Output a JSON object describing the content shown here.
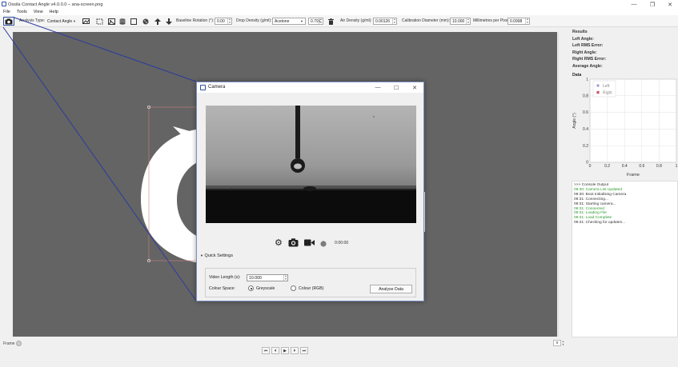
{
  "window": {
    "title": "Ossila Contact Angle v4.0.0.0 – ana-screen.png",
    "minimize": "—",
    "maximize": "❐",
    "close": "✕"
  },
  "menu": [
    "File",
    "Tools",
    "View",
    "Help"
  ],
  "toolbar": {
    "analysis_type_label": "Analysis Type:",
    "analysis_type_value": "Contact Angle",
    "baseline_rotation_label": "Baseline Rotation (°):",
    "baseline_rotation_value": "0.00",
    "drop_density_label": "Drop Density (g/ml):",
    "drop_density_value": "Acetone",
    "drop_density_number": "0.791",
    "air_density_label": "Air Density (g/ml):",
    "air_density_value": "0.00126",
    "calibration_label": "Calibration Diameter (mm):",
    "calibration_value": "10.000",
    "mm_per_pixel_label": "Millimetres per Pixel:",
    "mm_per_pixel_value": "0.0998"
  },
  "results": {
    "heading": "Results",
    "rows": [
      "Left Angle:",
      "Left RMS Error:",
      "Right Angle:",
      "Right RMS Error:",
      "Average Angle:"
    ]
  },
  "data_panel": {
    "heading": "Data",
    "legend_left": "Left",
    "legend_right": "Right",
    "ylabel": "Angle (°)",
    "xlabel": "Frame",
    "yticks": [
      "0",
      "0.2",
      "0.4",
      "0.6",
      "0.8",
      "1"
    ],
    "xticks": [
      "0",
      "0.2",
      "0.4",
      "0.6",
      "0.8",
      "1"
    ],
    "colors": {
      "left": "#9a9ad0",
      "right": "#cc5566"
    }
  },
  "console": {
    "lines": [
      {
        "text": ">>> Console Output",
        "status": "normal"
      },
      {
        "text": "09:30: Camera List Updated",
        "status": "success"
      },
      {
        "text": "09:30: Boot Initialising Camera",
        "status": "normal"
      },
      {
        "text": "09:31: Connecting...",
        "status": "normal"
      },
      {
        "text": "09:31: Starting camera...",
        "status": "normal"
      },
      {
        "text": "09:31: Connected",
        "status": "success"
      },
      {
        "text": "09:31: Loading File",
        "status": "success"
      },
      {
        "text": "09:31: Load Complete",
        "status": "success"
      },
      {
        "text": "09:31: Checking for updates...",
        "status": "normal"
      }
    ]
  },
  "status_bar": {
    "frame_label": "Frame",
    "frame_value": "0"
  },
  "dialog": {
    "title": "Camera",
    "timer": "0:00:00",
    "quick_settings_label": "Quick Settings",
    "video_length_label": "Video Length (s):",
    "video_length_value": "10.000",
    "colour_space_label": "Colour Space:",
    "greyscale_label": "Greyscale",
    "colour_label": "Colour (RGB)",
    "analyse_button": "Analyse Data"
  }
}
